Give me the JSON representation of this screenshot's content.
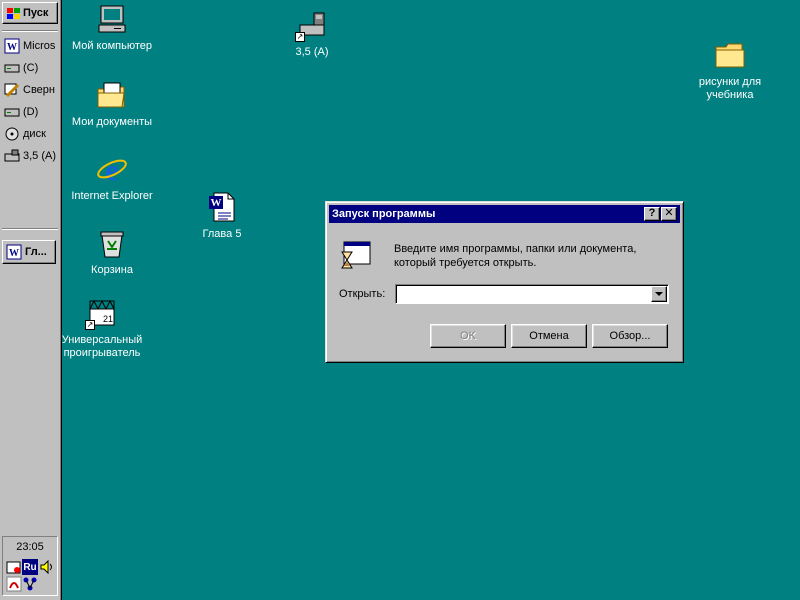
{
  "taskbar": {
    "start_label": "Пуск",
    "quick_launch": [
      {
        "label": "Micros",
        "icon": "word-icon"
      },
      {
        "label": "(C)",
        "icon": "drive-icon"
      },
      {
        "label": "Сверн",
        "icon": "minimize-windows-icon"
      },
      {
        "label": "(D)",
        "icon": "drive-icon"
      },
      {
        "label": "диск",
        "icon": "cd-drive-icon"
      },
      {
        "label": "3,5 (A)",
        "icon": "floppy-drive-icon"
      }
    ],
    "task_button": "Гл...",
    "clock": "23:05",
    "tray": {
      "lang": "Ru"
    }
  },
  "desktop": {
    "icons": [
      {
        "label": "Мой компьютер",
        "icon": "my-computer-icon"
      },
      {
        "label": "Мои документы",
        "icon": "my-documents-icon"
      },
      {
        "label": "Internet Explorer",
        "icon": "internet-explorer-icon"
      },
      {
        "label": "Корзина",
        "icon": "recycle-bin-icon"
      },
      {
        "label": "Универсальный проигрыватель",
        "icon": "media-player-icon"
      },
      {
        "label": "3,5 (A)",
        "icon": "floppy-drive-icon"
      },
      {
        "label": "Глава 5",
        "icon": "word-document-icon"
      },
      {
        "label": "рисунки для учебника",
        "icon": "folder-icon"
      }
    ]
  },
  "dialog": {
    "title": "Запуск программы",
    "help_label": "?",
    "close_label": "✕",
    "description": "Введите имя программы, папки или документа, который требуется открыть.",
    "open_label": "Открыть:",
    "input_value": "",
    "buttons": {
      "ok": "OK",
      "cancel": "Отмена",
      "browse": "Обзор..."
    }
  },
  "colors": {
    "desktop": "#008080",
    "titlebar": "#000080",
    "face": "#c0c0c0"
  }
}
